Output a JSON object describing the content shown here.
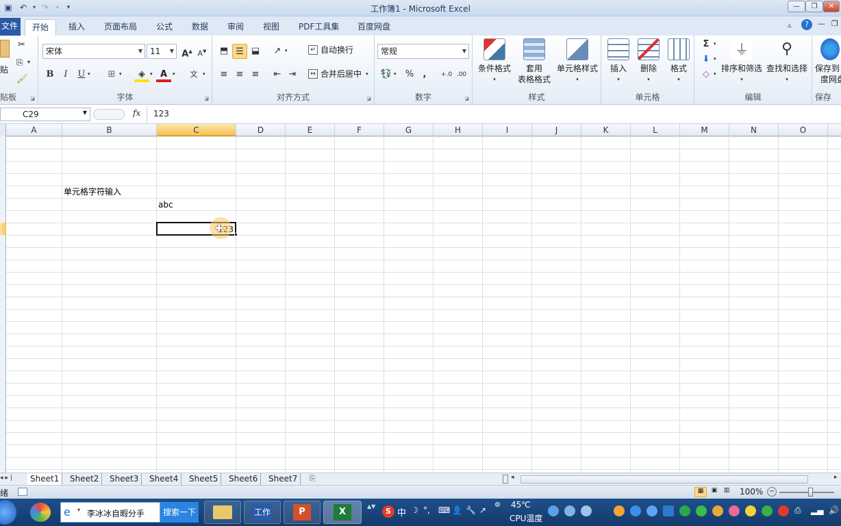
{
  "window": {
    "title": "工作簿1 - Microsoft Excel"
  },
  "tabs": [
    {
      "label": "文件"
    },
    {
      "label": "开始"
    },
    {
      "label": "插入"
    },
    {
      "label": "页面布局"
    },
    {
      "label": "公式"
    },
    {
      "label": "数据"
    },
    {
      "label": "审阅"
    },
    {
      "label": "视图"
    },
    {
      "label": "PDF工具集"
    },
    {
      "label": "百度网盘"
    }
  ],
  "ribbon": {
    "clipboard": {
      "label": "贴板",
      "paste": "贴"
    },
    "font": {
      "label": "字体",
      "name": "宋体",
      "size": "11"
    },
    "align": {
      "label": "对齐方式",
      "wrap": "自动换行",
      "merge": "合并后居中"
    },
    "number": {
      "label": "数字",
      "format": "常规"
    },
    "styles": {
      "label": "样式",
      "conditional": "条件格式",
      "table1": "套用",
      "table2": "表格格式",
      "cellstyle": "单元格样式"
    },
    "cells": {
      "label": "单元格",
      "insert": "插入",
      "delete": "删除",
      "format": "格式"
    },
    "edit": {
      "label": "编辑",
      "sort": "排序和筛选",
      "find": "查找和选择"
    },
    "save": {
      "label": "保存",
      "l1": "保存到",
      "l2": "度网盘"
    }
  },
  "formula": {
    "namebox": "C29",
    "fx": "fx",
    "value": "123"
  },
  "columns": [
    "A",
    "B",
    "C",
    "D",
    "E",
    "F",
    "G",
    "H",
    "I",
    "J",
    "K",
    "L",
    "M",
    "N",
    "O"
  ],
  "cells": {
    "b_text": "单元格字符输入",
    "c_text": "abc",
    "c_value": "123"
  },
  "sheets": [
    "Sheet1",
    "Sheet2",
    "Sheet3",
    "Sheet4",
    "Sheet5",
    "Sheet6",
    "Sheet7"
  ],
  "status": {
    "mode": "绪",
    "zoom": "100%"
  },
  "taskbar": {
    "ie_label": "李冰冰自暇分手",
    "search": "搜索一下",
    "app_label": "工作",
    "ime": "中",
    "temp": "45℃",
    "temp_label": "CPU温度"
  },
  "colors": {
    "accent": "#2a5aa8",
    "selection": "#f6c25a"
  }
}
